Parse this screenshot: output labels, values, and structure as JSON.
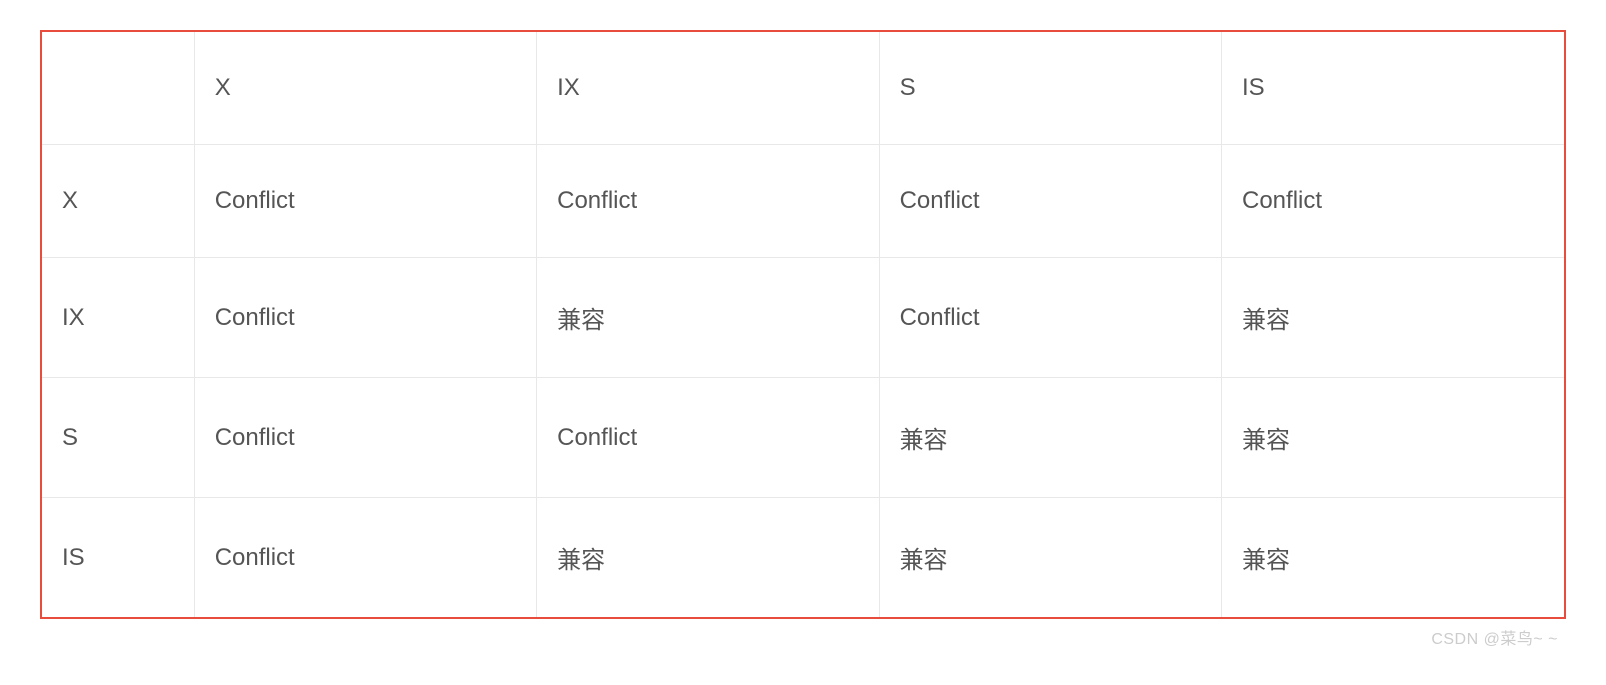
{
  "chart_data": {
    "type": "table",
    "title": "",
    "columns": [
      "",
      "X",
      "IX",
      "S",
      "IS"
    ],
    "rows": [
      {
        "label": "X",
        "cells": [
          "Conflict",
          "Conflict",
          "Conflict",
          "Conflict"
        ]
      },
      {
        "label": "IX",
        "cells": [
          "Conflict",
          "兼容",
          "Conflict",
          "兼容"
        ]
      },
      {
        "label": "S",
        "cells": [
          "Conflict",
          "Conflict",
          "兼容",
          "兼容"
        ]
      },
      {
        "label": "IS",
        "cells": [
          "Conflict",
          "兼容",
          "兼容",
          "兼容"
        ]
      }
    ]
  },
  "watermark": "CSDN @菜鸟~ ~"
}
